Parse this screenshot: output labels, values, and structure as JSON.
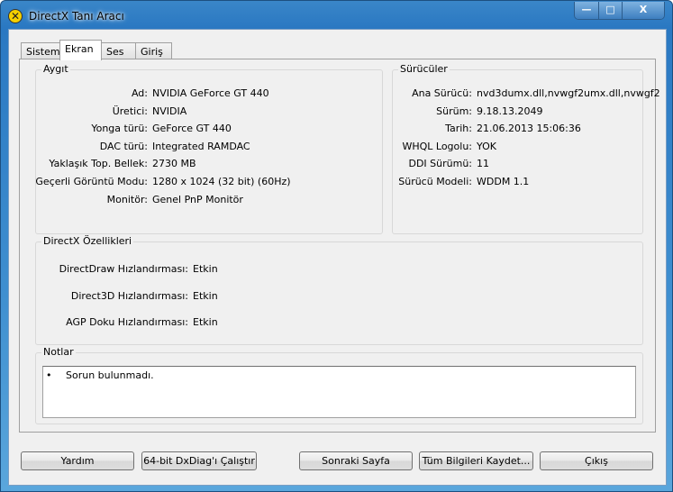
{
  "window": {
    "title": "DirectX Tanı Aracı",
    "minimize": "—",
    "maximize": "□",
    "close": "X",
    "icon": "directx-icon"
  },
  "tabs": [
    {
      "label": "Sistem"
    },
    {
      "label": "Ekran"
    },
    {
      "label": "Ses"
    },
    {
      "label": "Giriş"
    }
  ],
  "device": {
    "legend": "Aygıt",
    "rows": [
      {
        "label": "Ad:",
        "value": "NVIDIA GeForce GT 440"
      },
      {
        "label": "Üretici:",
        "value": "NVIDIA"
      },
      {
        "label": "Yonga türü:",
        "value": "GeForce GT 440"
      },
      {
        "label": "DAC türü:",
        "value": "Integrated RAMDAC"
      },
      {
        "label": "Yaklaşık Top. Bellek:",
        "value": "2730 MB"
      },
      {
        "label": "Geçerli Görüntü Modu:",
        "value": "1280 x 1024 (32 bit) (60Hz)"
      },
      {
        "label": "Monitör:",
        "value": "Genel PnP Monitör"
      }
    ]
  },
  "drivers": {
    "legend": "Sürücüler",
    "rows": [
      {
        "label": "Ana Sürücü:",
        "value": "nvd3dumx.dll,nvwgf2umx.dll,nvwgf2"
      },
      {
        "label": "Sürüm:",
        "value": "9.18.13.2049"
      },
      {
        "label": "Tarih:",
        "value": "21.06.2013 15:06:36"
      },
      {
        "label": "WHQL Logolu:",
        "value": "YOK"
      },
      {
        "label": "DDI Sürümü:",
        "value": "11"
      },
      {
        "label": "Sürücü Modeli:",
        "value": "WDDM 1.1"
      }
    ]
  },
  "features": {
    "legend": "DirectX Özellikleri",
    "rows": [
      {
        "label": "DirectDraw Hızlandırması:",
        "value": "Etkin"
      },
      {
        "label": "Direct3D Hızlandırması:",
        "value": "Etkin"
      },
      {
        "label": "AGP Doku Hızlandırması:",
        "value": "Etkin"
      }
    ]
  },
  "notes": {
    "legend": "Notlar",
    "items": [
      "Sorun bulunmadı."
    ]
  },
  "buttons": {
    "help": "Yardım",
    "run64": "64-bit DxDiag'ı Çalıştır",
    "next": "Sonraki Sayfa",
    "save": "Tüm Bilgileri Kaydet...",
    "exit": "Çıkış"
  }
}
